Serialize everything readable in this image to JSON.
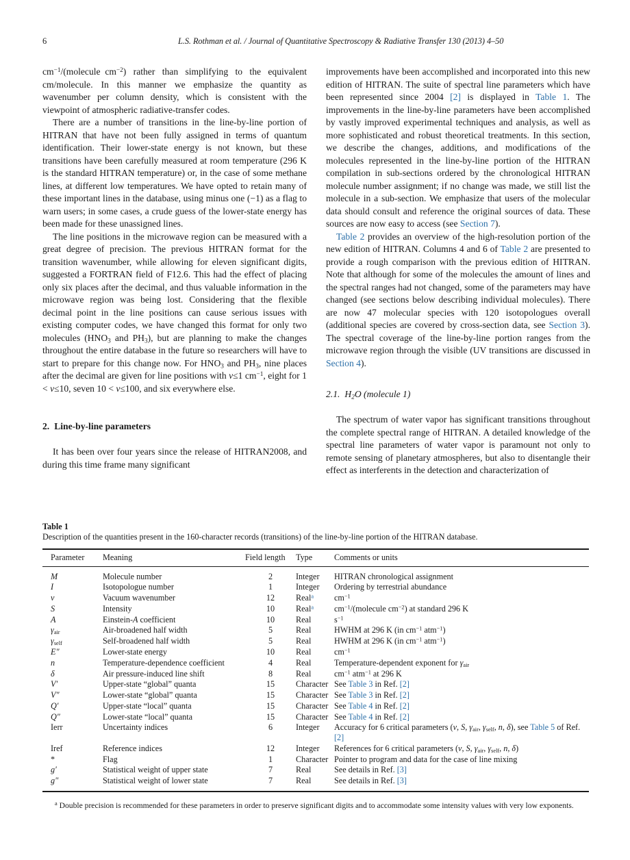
{
  "runninghead": {
    "page_number": "6",
    "citation": "L.S. Rothman et al. / Journal of Quantitative Spectroscopy & Radiative Transfer 130 (2013) 4–50"
  },
  "colors": {
    "link": "#2b6fa8",
    "text": "#1a1a1a",
    "background": "#ffffff"
  },
  "left_column": {
    "p1_part1": "cm",
    "p1_sup1": "−1",
    "p1_part2": "/(molecule cm",
    "p1_sup2": "−2",
    "p1_part3": ") rather than simplifying to the equivalent cm/molecule. In this manner we emphasize the quantity as wavenumber per column density, which is consistent with the viewpoint of atmospheric radiative-transfer codes.",
    "p2": "There are a number of transitions in the line-by-line portion of HITRAN that have not been fully assigned in terms of quantum identification. Their lower-state energy is not known, but these transitions have been carefully measured at room temperature (296 K is the standard HITRAN temperature) or, in the case of some methane lines, at different low temperatures. We have opted to retain many of these important lines in the database, using minus one (−1) as a flag to warn users; in some cases, a crude guess of the lower-state energy has been made for these unassigned lines.",
    "p3_a": "The line positions in the microwave region can be measured with a great degree of precision. The previous HITRAN format for the transition wavenumber, while allowing for eleven significant digits, suggested a FORTRAN field of F12.6. This had the effect of placing only six places after the decimal, and thus valuable information in the microwave region was being lost. Considering that the flexible decimal point in the line positions can cause serious issues with existing computer codes, we have changed this format for only two molecules (HNO",
    "p3_sub1": "3",
    "p3_b": " and PH",
    "p3_sub2": "3",
    "p3_c": "), but are planning to make the changes throughout the entire database in the future so researchers will have to start to prepare for this change now. For HNO",
    "p3_sub3": "3",
    "p3_d": " and PH",
    "p3_sub4": "3",
    "p3_e": ", nine places after the decimal are given for line positions with ",
    "p3_nu1": "ν",
    "p3_f": "≤1 cm",
    "p3_sup": "−1",
    "p3_g": ", eight for 1 < ",
    "p3_nu2": "ν",
    "p3_h": "≤10, seven 10 < ",
    "p3_nu3": "ν",
    "p3_i": "≤100, and six everywhere else.",
    "section_number": "2.",
    "section_title": "Line-by-line parameters",
    "p4": "It has been over four years since the release of HITRAN2008, and during this time frame many significant"
  },
  "right_column": {
    "p1_a": "improvements have been accomplished and incorporated into this new edition of HITRAN. The suite of spectral line parameters which have been represented since 2004 ",
    "p1_link1": "[2]",
    "p1_b": " is displayed in ",
    "p1_link2": "Table 1",
    "p1_c": ". The improvements in the line-by-line parameters have been accomplished by vastly improved experimental techniques and analysis, as well as more sophisticated and robust theoretical treatments. In this section, we describe the changes, additions, and modifications of the molecules represented in the line-by-line portion of the HITRAN compilation in sub-sections ordered by the chronological HITRAN molecule number assignment; if no change was made, we still list the molecule in a sub-section. We emphasize that users of the molecular data should consult and reference the original sources of data. These sources are now easy to access (see ",
    "p1_link3": "Section 7",
    "p1_d": ").",
    "p2_link1": "Table 2",
    "p2_a": " provides an overview of the high-resolution portion of the new edition of HITRAN. Columns 4 and 6 of ",
    "p2_link2": "Table 2",
    "p2_b": " are presented to provide a rough comparison with the previous edition of HITRAN. Note that although for some of the molecules the amount of lines and the spectral ranges had not changed, some of the parameters may have changed (see sections below describing individual molecules). There are now 47 molecular species with 120 isotopologues overall (additional species are covered by cross-section data, see ",
    "p2_link3": "Section 3",
    "p2_c": "). The spectral coverage of the line-by-line portion ranges from the microwave region through the visible (UV transitions are discussed in ",
    "p2_link4": "Section 4",
    "p2_d": ").",
    "subsection_number": "2.1.",
    "subsection_title_a": "H",
    "subsection_title_sub": "2",
    "subsection_title_b": "O (molecule 1)",
    "p3": "The spectrum of water vapor has significant transitions throughout the complete spectral range of HITRAN. A detailed knowledge of the spectral line parameters of water vapor is paramount not only to remote sensing of planetary atmospheres, but also to disentangle their effect as interferents in the detection and characterization of"
  },
  "table1": {
    "label": "Table 1",
    "caption": "Description of the quantities present in the 160-character records (transitions) of the line-by-line portion of the HITRAN database.",
    "columns": [
      "Parameter",
      "Meaning",
      "Field length",
      "Type",
      "Comments or units"
    ],
    "rows": [
      {
        "parameter": "M",
        "parameter_style": "italic",
        "meaning": "Molecule number",
        "field_length": "2",
        "type": "Integer",
        "comments": "HITRAN chronological assignment"
      },
      {
        "parameter": "I",
        "parameter_style": "italic",
        "meaning": "Isotopologue number",
        "field_length": "1",
        "type": "Integer",
        "comments": "Ordering by terrestrial abundance"
      },
      {
        "parameter": "ν",
        "parameter_style": "italic",
        "meaning": "Vacuum wavenumber",
        "field_length": "12",
        "type": "Real",
        "type_footnote": "a",
        "comments": "cm−1"
      },
      {
        "parameter": "S",
        "parameter_style": "italic",
        "meaning": "Intensity",
        "field_length": "10",
        "type": "Real",
        "type_footnote": "a",
        "comments": "cm−1/(molecule cm−2) at standard 296 K"
      },
      {
        "parameter": "A",
        "parameter_style": "italic",
        "meaning": "Einstein-A coefficient",
        "field_length": "10",
        "type": "Real",
        "comments": "s−1"
      },
      {
        "parameter": "γair",
        "parameter_style": "italic-sub",
        "meaning": "Air-broadened half width",
        "field_length": "5",
        "type": "Real",
        "comments": "HWHM at 296 K (in cm−1 atm−1)"
      },
      {
        "parameter": "γself",
        "parameter_style": "italic-sub",
        "meaning": "Self-broadened half width",
        "field_length": "5",
        "type": "Real",
        "comments": "HWHM at 296 K (in cm−1 atm−1)"
      },
      {
        "parameter": "E″",
        "parameter_style": "italic",
        "meaning": "Lower-state energy",
        "field_length": "10",
        "type": "Real",
        "comments": "cm−1"
      },
      {
        "parameter": "n",
        "parameter_style": "italic",
        "meaning": "Temperature-dependence coefficient",
        "field_length": "4",
        "type": "Real",
        "comments": "Temperature-dependent exponent for γair"
      },
      {
        "parameter": "δ",
        "parameter_style": "italic",
        "meaning": "Air pressure-induced line shift",
        "field_length": "8",
        "type": "Real",
        "comments": "cm−1 atm−1 at 296 K"
      },
      {
        "parameter": "V′",
        "parameter_style": "italic",
        "meaning": "Upper-state “global” quanta",
        "field_length": "15",
        "type": "Character",
        "comments": "See Table 3 in Ref. [2]",
        "links": [
          "Table 3",
          "[2]"
        ]
      },
      {
        "parameter": "V″",
        "parameter_style": "italic",
        "meaning": "Lower-state “global” quanta",
        "field_length": "15",
        "type": "Character",
        "comments": "See Table 3 in Ref. [2]",
        "links": [
          "Table 3",
          "[2]"
        ]
      },
      {
        "parameter": "Q′",
        "parameter_style": "italic",
        "meaning": "Upper-state “local” quanta",
        "field_length": "15",
        "type": "Character",
        "comments": "See Table 4 in Ref. [2]",
        "links": [
          "Table 4",
          "[2]"
        ]
      },
      {
        "parameter": "Q″",
        "parameter_style": "italic",
        "meaning": "Lower-state “local” quanta",
        "field_length": "15",
        "type": "Character",
        "comments": "See Table 4 in Ref. [2]",
        "links": [
          "Table 4",
          "[2]"
        ]
      },
      {
        "parameter": "Ierr",
        "parameter_style": "roman",
        "meaning": "Uncertainty indices",
        "field_length": "6",
        "type": "Integer",
        "comments": "Accuracy for 6 critical parameters (ν, S, γair, γself, n, δ), see Table 5 of Ref. [2]",
        "links": [
          "Table 5",
          "[2]"
        ]
      },
      {
        "parameter": "Iref",
        "parameter_style": "roman",
        "meaning": "Reference indices",
        "field_length": "12",
        "type": "Integer",
        "comments": "References for 6 critical parameters (ν, S, γair, γself, n, δ)"
      },
      {
        "parameter": "*",
        "parameter_style": "roman",
        "meaning": "Flag",
        "field_length": "1",
        "type": "Character",
        "comments": "Pointer to program and data for the case of line mixing"
      },
      {
        "parameter": "g′",
        "parameter_style": "italic",
        "meaning": "Statistical weight of upper state",
        "field_length": "7",
        "type": "Real",
        "comments": "See details in Ref. [3]",
        "links": [
          "[3]"
        ]
      },
      {
        "parameter": "g″",
        "parameter_style": "italic",
        "meaning": "Statistical weight of lower state",
        "field_length": "7",
        "type": "Real",
        "comments": "See details in Ref. [3]",
        "links": [
          "[3]"
        ]
      }
    ],
    "footnote_marker": "a",
    "footnote_text": "Double precision is recommended for these parameters in order to preserve significant digits and to accommodate some intensity values with very low exponents."
  }
}
